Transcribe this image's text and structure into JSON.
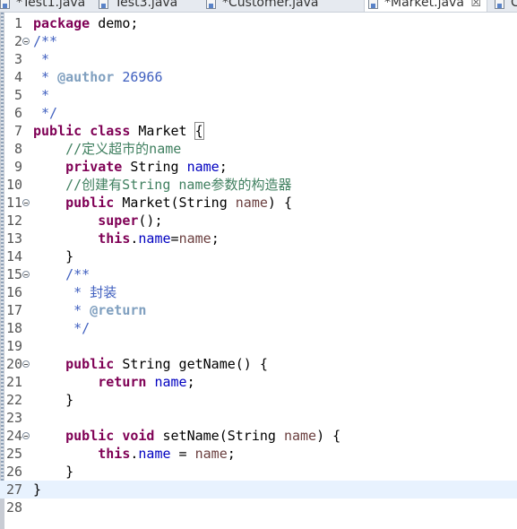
{
  "tabs": [
    {
      "label": "*Test1.java",
      "active": false
    },
    {
      "label": "Test3.java",
      "active": false
    },
    {
      "label": "*Customer.java",
      "active": false
    },
    {
      "label": "*Market.java",
      "active": true,
      "close": "☒"
    },
    {
      "label": "C",
      "active": false
    }
  ],
  "editor": {
    "current_line": 27,
    "lines": [
      {
        "n": "1",
        "tokens": [
          [
            "kw",
            "package"
          ],
          [
            "txt",
            " demo;"
          ]
        ]
      },
      {
        "n": "2",
        "fold": true,
        "tokens": [
          [
            "jd",
            "/**"
          ]
        ]
      },
      {
        "n": "3",
        "tokens": [
          [
            "jd",
            " *"
          ]
        ]
      },
      {
        "n": "4",
        "tokens": [
          [
            "jd",
            " * "
          ],
          [
            "tag",
            "@author"
          ],
          [
            "jd",
            " 26966"
          ]
        ]
      },
      {
        "n": "5",
        "tokens": [
          [
            "jd",
            " *"
          ]
        ]
      },
      {
        "n": "6",
        "tokens": [
          [
            "jd",
            " */"
          ]
        ]
      },
      {
        "n": "7",
        "tokens": [
          [
            "kw",
            "public"
          ],
          [
            "txt",
            " "
          ],
          [
            "kw",
            "class"
          ],
          [
            "txt",
            " Market "
          ],
          [
            "brace",
            "{"
          ]
        ]
      },
      {
        "n": "8",
        "tokens": [
          [
            "txt",
            "    "
          ],
          [
            "cm",
            "//定义超市的name"
          ]
        ]
      },
      {
        "n": "9",
        "tokens": [
          [
            "txt",
            "    "
          ],
          [
            "kw",
            "private"
          ],
          [
            "txt",
            " String "
          ],
          [
            "fld",
            "name"
          ],
          [
            "txt",
            ";"
          ]
        ]
      },
      {
        "n": "10",
        "tokens": [
          [
            "txt",
            "    "
          ],
          [
            "cm",
            "//创建有String name参数的构造器"
          ]
        ]
      },
      {
        "n": "11",
        "fold": true,
        "tokens": [
          [
            "txt",
            "    "
          ],
          [
            "kw",
            "public"
          ],
          [
            "txt",
            " Market(String "
          ],
          [
            "par",
            "name"
          ],
          [
            "txt",
            ") {"
          ]
        ]
      },
      {
        "n": "12",
        "tokens": [
          [
            "txt",
            "        "
          ],
          [
            "kw",
            "super"
          ],
          [
            "txt",
            "();"
          ]
        ]
      },
      {
        "n": "13",
        "tokens": [
          [
            "txt",
            "        "
          ],
          [
            "kw",
            "this"
          ],
          [
            "txt",
            "."
          ],
          [
            "fld",
            "name"
          ],
          [
            "txt",
            "="
          ],
          [
            "par",
            "name"
          ],
          [
            "txt",
            ";"
          ]
        ]
      },
      {
        "n": "14",
        "tokens": [
          [
            "txt",
            "    }"
          ]
        ]
      },
      {
        "n": "15",
        "fold": true,
        "tokens": [
          [
            "txt",
            "    "
          ],
          [
            "jd",
            "/**"
          ]
        ]
      },
      {
        "n": "16",
        "tokens": [
          [
            "jd",
            "     * 封装"
          ]
        ]
      },
      {
        "n": "17",
        "tokens": [
          [
            "jd",
            "     * "
          ],
          [
            "tag",
            "@return"
          ]
        ]
      },
      {
        "n": "18",
        "tokens": [
          [
            "jd",
            "     */"
          ]
        ]
      },
      {
        "n": "19",
        "tokens": []
      },
      {
        "n": "20",
        "fold": true,
        "tokens": [
          [
            "txt",
            "    "
          ],
          [
            "kw",
            "public"
          ],
          [
            "txt",
            " String getName() {"
          ]
        ]
      },
      {
        "n": "21",
        "tokens": [
          [
            "txt",
            "        "
          ],
          [
            "kw",
            "return"
          ],
          [
            "txt",
            " "
          ],
          [
            "fld",
            "name"
          ],
          [
            "txt",
            ";"
          ]
        ]
      },
      {
        "n": "22",
        "tokens": [
          [
            "txt",
            "    }"
          ]
        ]
      },
      {
        "n": "23",
        "tokens": []
      },
      {
        "n": "24",
        "fold": true,
        "tokens": [
          [
            "txt",
            "    "
          ],
          [
            "kw",
            "public"
          ],
          [
            "txt",
            " "
          ],
          [
            "kw",
            "void"
          ],
          [
            "txt",
            " setName(String "
          ],
          [
            "par",
            "name"
          ],
          [
            "txt",
            ") {"
          ]
        ]
      },
      {
        "n": "25",
        "tokens": [
          [
            "txt",
            "        "
          ],
          [
            "kw",
            "this"
          ],
          [
            "txt",
            "."
          ],
          [
            "fld",
            "name"
          ],
          [
            "txt",
            " = "
          ],
          [
            "par",
            "name"
          ],
          [
            "txt",
            ";"
          ]
        ]
      },
      {
        "n": "26",
        "tokens": [
          [
            "txt",
            "    }"
          ]
        ]
      },
      {
        "n": "27",
        "tokens": [
          [
            "txt",
            "}"
          ]
        ]
      },
      {
        "n": "28",
        "tokens": []
      }
    ]
  }
}
